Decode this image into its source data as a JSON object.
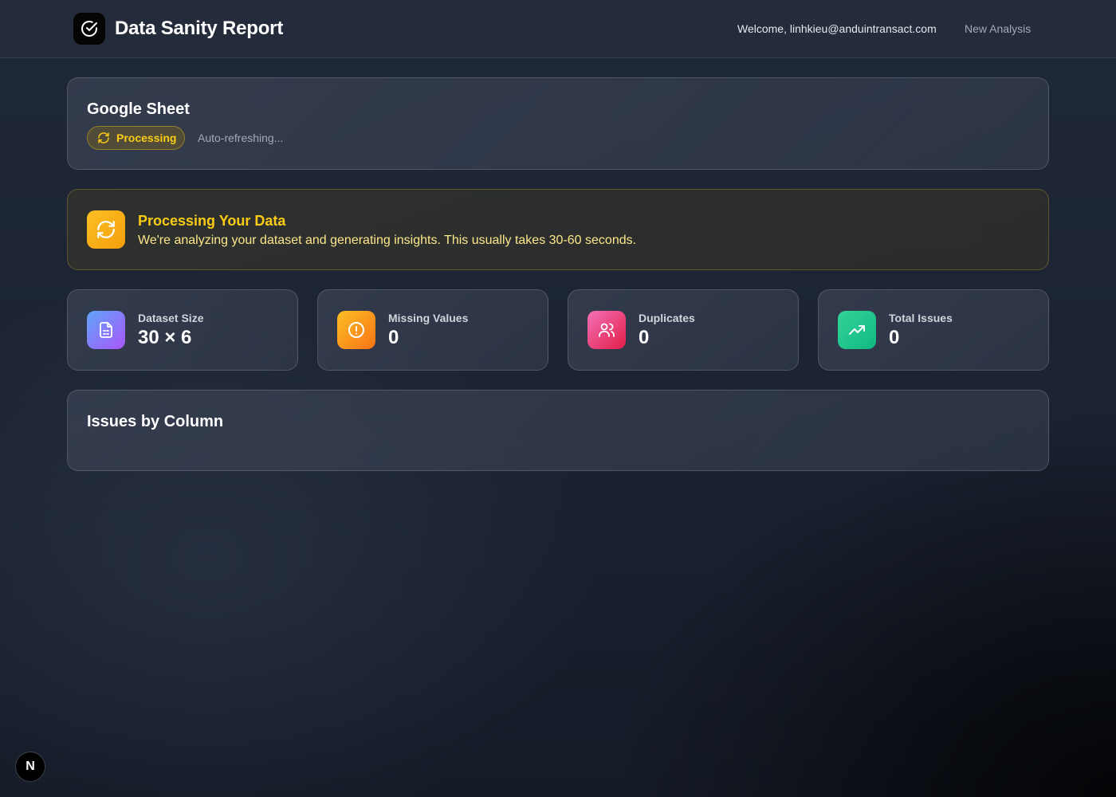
{
  "header": {
    "app_title": "Data Sanity Report",
    "logo_icon": "check-circle-icon",
    "welcome": "Welcome, linhkieu@anduintransact.com",
    "new_analysis": "New Analysis"
  },
  "source": {
    "title": "Google Sheet",
    "status": "Processing",
    "status_icon": "refresh-icon",
    "status_color": "#facc15",
    "refresh_note": "Auto-refreshing..."
  },
  "processing": {
    "title": "Processing Your Data",
    "description": "We're analyzing your dataset and generating insights. This usually takes 30-60 seconds.",
    "icon": "refresh-icon"
  },
  "stats": [
    {
      "label": "Dataset Size",
      "value": "30 × 6",
      "icon": "document-icon",
      "color": "#8b5cf6"
    },
    {
      "label": "Missing Values",
      "value": "0",
      "icon": "alert-circle-icon",
      "color": "#f59e0b"
    },
    {
      "label": "Duplicates",
      "value": "0",
      "icon": "users-icon",
      "color": "#ec4899"
    },
    {
      "label": "Total Issues",
      "value": "0",
      "icon": "trending-up-icon",
      "color": "#10b981"
    }
  ],
  "issues": {
    "title": "Issues by Column"
  },
  "dev_badge": {
    "label": "N"
  }
}
